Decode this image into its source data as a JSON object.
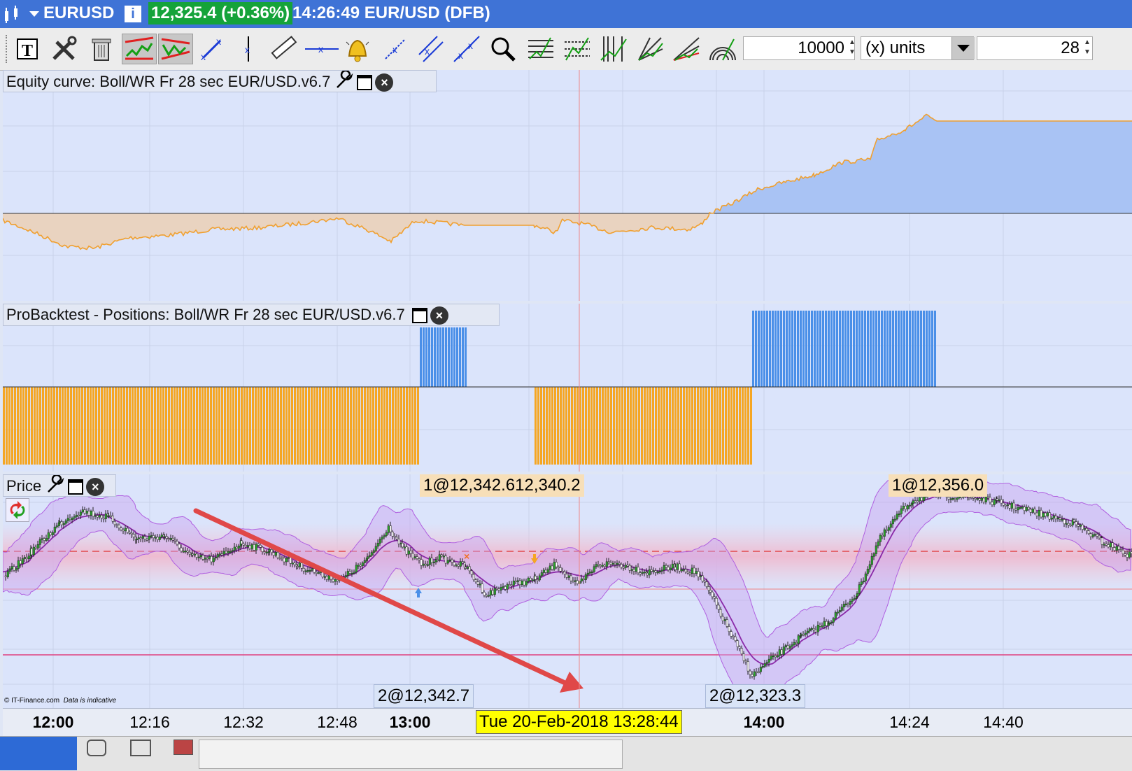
{
  "window": {
    "symbol": "EURUSD",
    "price": "12,325.4 (+0.36%)",
    "time_info": "14:26:49 EUR/USD (DFB)",
    "price_color": "#15a33a"
  },
  "toolbar": {
    "quantity": "10000",
    "unit_select": "(x) units",
    "period": "28",
    "icons": [
      "text-tool",
      "draw-tools",
      "trash",
      "trend-line",
      "triangle",
      "segment",
      "vertical-line",
      "ruler",
      "horizontal-line",
      "alert-bell",
      "line-arrow",
      "parallel-lines",
      "half-line",
      "zoom",
      "fibo-retracement",
      "fibo-levels",
      "fibo-timezones",
      "gann-fan",
      "speed-lines",
      "fibo-arcs"
    ]
  },
  "panels": {
    "equity": {
      "title": "Equity curve: Boll/WR Fr 28 sec EUR/USD.v6.7"
    },
    "positions": {
      "title": "ProBacktest - Positions: Boll/WR Fr 28 sec EUR/USD.v6.7"
    },
    "price": {
      "title": "Price",
      "label_top_left": "1@12,342.612,340.2",
      "label_top_right": "1@12,356.0",
      "label_bottom_left": "2@12,342.7",
      "label_bottom_right": "2@12,323.3",
      "copyright": "© IT-Finance.com",
      "disclaimer": "Data is indicative"
    }
  },
  "xaxis": {
    "ticks": [
      {
        "label": "12:00",
        "bold": true
      },
      {
        "label": "12:16",
        "bold": false
      },
      {
        "label": "12:32",
        "bold": false
      },
      {
        "label": "12:48",
        "bold": false
      },
      {
        "label": "13:00",
        "bold": true
      },
      {
        "label": "14:00",
        "bold": true
      },
      {
        "label": "14:24",
        "bold": false
      },
      {
        "label": "14:40",
        "bold": false
      }
    ],
    "cursor_label": "Tue 20-Feb-2018 13:28:44"
  },
  "colors": {
    "blue_position": "#4a8fe8",
    "orange_position": "#f5a623",
    "arrow": "#e04848",
    "bollinger": "#b060e0",
    "equity_line": "#f0a030"
  }
}
